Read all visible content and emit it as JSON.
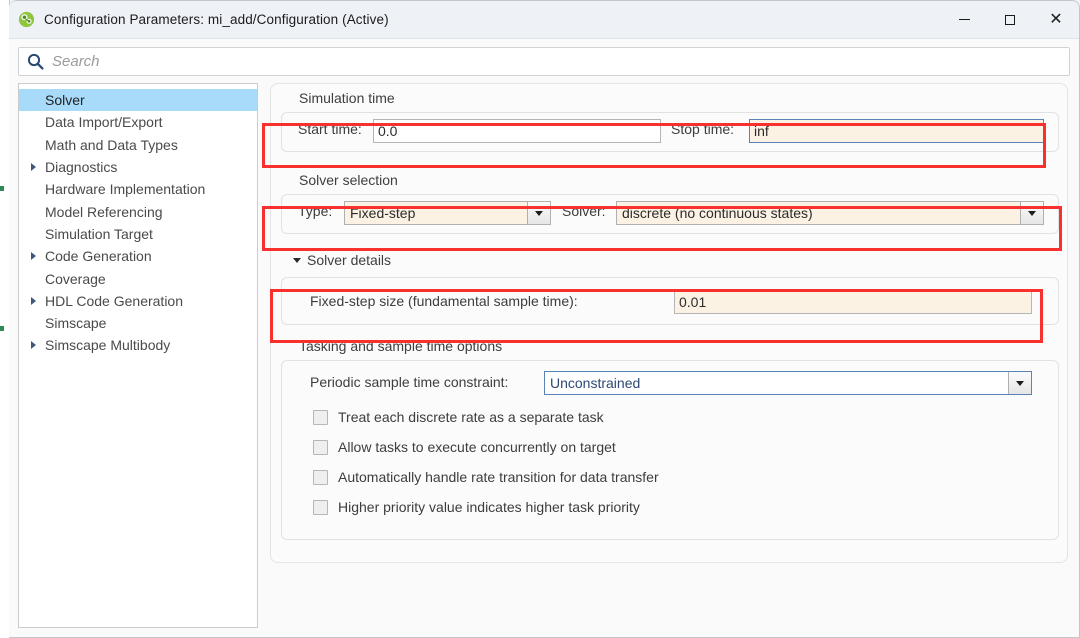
{
  "window": {
    "title": "Configuration Parameters: mi_add/Configuration (Active)",
    "app_icon": "simulink-icon",
    "controls": {
      "minimize": "minimize-icon",
      "maximize": "maximize-icon",
      "close": "close-icon"
    }
  },
  "search": {
    "icon": "search-icon",
    "placeholder": "Search",
    "value": ""
  },
  "sidebar": {
    "items": [
      {
        "label": "Solver",
        "expandable": false,
        "selected": true
      },
      {
        "label": "Data Import/Export",
        "expandable": false,
        "selected": false
      },
      {
        "label": "Math and Data Types",
        "expandable": false,
        "selected": false
      },
      {
        "label": "Diagnostics",
        "expandable": true,
        "selected": false
      },
      {
        "label": "Hardware Implementation",
        "expandable": false,
        "selected": false
      },
      {
        "label": "Model Referencing",
        "expandable": false,
        "selected": false
      },
      {
        "label": "Simulation Target",
        "expandable": false,
        "selected": false
      },
      {
        "label": "Code Generation",
        "expandable": true,
        "selected": false
      },
      {
        "label": "Coverage",
        "expandable": false,
        "selected": false
      },
      {
        "label": "HDL Code Generation",
        "expandable": true,
        "selected": false
      },
      {
        "label": "Simscape",
        "expandable": false,
        "selected": false
      },
      {
        "label": "Simscape Multibody",
        "expandable": true,
        "selected": false
      }
    ]
  },
  "main": {
    "simulation_time": {
      "section_label": "Simulation time",
      "start_time_label": "Start time:",
      "start_time_value": "0.0",
      "stop_time_label": "Stop time:",
      "stop_time_value": "inf"
    },
    "solver_selection": {
      "section_label": "Solver selection",
      "type_label": "Type:",
      "type_value": "Fixed-step",
      "solver_label": "Solver:",
      "solver_value": "discrete (no continuous states)"
    },
    "solver_details": {
      "section_label": "Solver details",
      "fixed_step_label": "Fixed-step size (fundamental sample time):",
      "fixed_step_value": "0.01"
    },
    "tasking": {
      "section_label": "Tasking and sample time options",
      "constraint_label": "Periodic sample time constraint:",
      "constraint_value": "Unconstrained",
      "checkboxes": [
        {
          "label": "Treat each discrete rate as a separate task",
          "checked": false
        },
        {
          "label": "Allow tasks to execute concurrently on target",
          "checked": false
        },
        {
          "label": "Automatically handle rate transition for data transfer",
          "checked": false
        },
        {
          "label": "Higher priority value indicates higher task priority",
          "checked": false
        }
      ]
    }
  },
  "annotations": {
    "color": "#f8312f",
    "boxes": [
      {
        "name": "simulation-time-highlight"
      },
      {
        "name": "solver-selection-highlight"
      },
      {
        "name": "solver-details-highlight"
      }
    ]
  },
  "colors": {
    "selection_blue": "#a8dafa",
    "edited_field_cream": "#fcf2e4",
    "focus_border_blue": "#5b83b5",
    "annotation_red": "#f8312f"
  }
}
